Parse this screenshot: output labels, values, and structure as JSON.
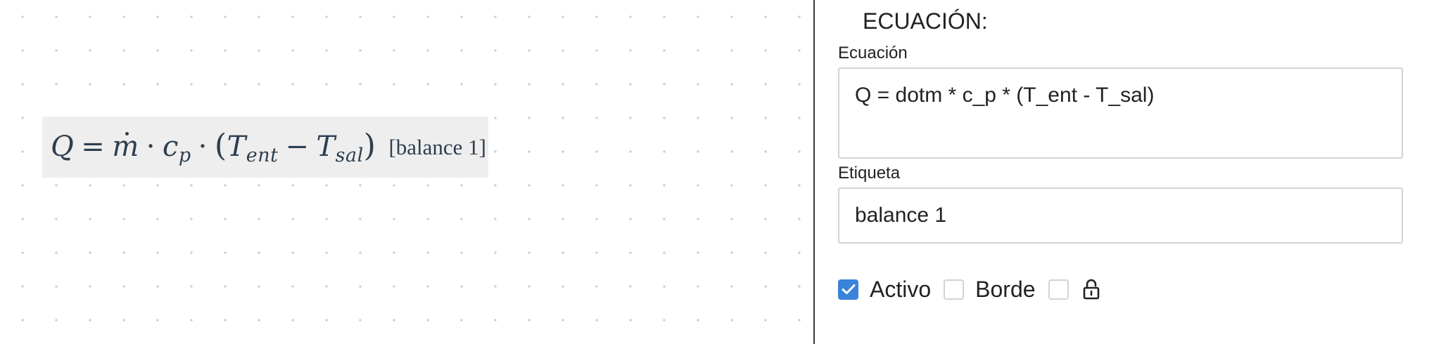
{
  "canvas": {
    "equation": {
      "lhs": "Q",
      "equals": "=",
      "mdot": "m",
      "dot1": "·",
      "c": "c",
      "c_sub": "p",
      "dot2": "·",
      "lparen": "(",
      "t1": "T",
      "t1_sub": "ent",
      "minus": "−",
      "t2": "T",
      "t2_sub": "sal",
      "rparen": ")",
      "tag": "[balance 1]"
    }
  },
  "panel": {
    "title": "ECUACIÓN:",
    "equation_label": "Ecuación",
    "equation_value": "Q = dotm * c_p * (T_ent - T_sal)",
    "tag_label": "Etiqueta",
    "tag_value": "balance 1",
    "checkboxes": [
      {
        "label": "Activo",
        "checked": true
      },
      {
        "label": "Borde",
        "checked": false
      },
      {
        "label": "",
        "checked": false,
        "icon": "lock-icon"
      }
    ]
  },
  "colors": {
    "accent": "#3b82d9",
    "equation_text": "#2d3e50",
    "equation_bg": "#eeeeee",
    "border": "#ced4da"
  }
}
